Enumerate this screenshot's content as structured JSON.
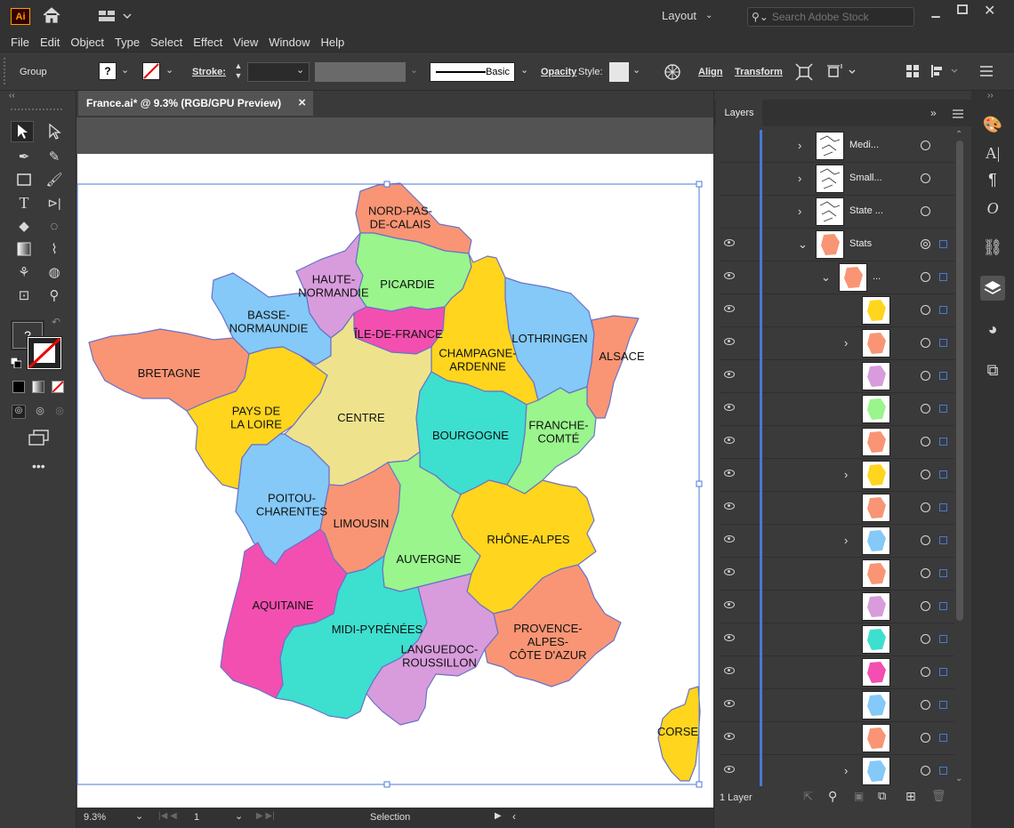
{
  "app": {
    "logo": "Ai",
    "layout_label": "Layout",
    "search_placeholder": "Search Adobe Stock"
  },
  "menu": [
    "File",
    "Edit",
    "Object",
    "Type",
    "Select",
    "Effect",
    "View",
    "Window",
    "Help"
  ],
  "control_bar": {
    "selection_type": "Group",
    "fill_value": "?",
    "stroke_label": "Stroke:",
    "brush_label": "Basic",
    "opacity_label": "Opacity",
    "style_label": "Style:",
    "align_label": "Align",
    "transform_label": "Transform"
  },
  "document": {
    "tab_title": "France.ai* @ 9.3% (RGB/GPU Preview)",
    "close_glyph": "×"
  },
  "status_bar": {
    "zoom": "9.3%",
    "artboard_number": "1",
    "tool_name": "Selection"
  },
  "map": {
    "regions": [
      {
        "name": "NORD-PAS-\nDE-CALAIS",
        "color": "#F99574"
      },
      {
        "name": "PICARDIE",
        "color": "#99F58C"
      },
      {
        "name": "HAUTE-\nNORMANDIE",
        "color": "#D89CDC"
      },
      {
        "name": "BASSE-\nNORMAUNDIE",
        "color": "#84C9F8"
      },
      {
        "name": "ÎLE-DE-FRANCE",
        "color": "#F34FB0"
      },
      {
        "name": "CHAMPAGNE-\nARDENNE",
        "color": "#FFD51D"
      },
      {
        "name": "LOTHRINGEN",
        "color": "#84C9F8"
      },
      {
        "name": "ALSACE",
        "color": "#F99574"
      },
      {
        "name": "BRETAGNE",
        "color": "#F99574"
      },
      {
        "name": "PAYS DE\nLA LOIRE",
        "color": "#FFD51D"
      },
      {
        "name": "CENTRE",
        "color": "#EEE38C"
      },
      {
        "name": "BOURGOGNE",
        "color": "#3DDFCF"
      },
      {
        "name": "FRANCHE-\nCOMTÉ",
        "color": "#99F58C"
      },
      {
        "name": "POITOU-\nCHARENTES",
        "color": "#84C9F8"
      },
      {
        "name": "LIMOUSIN",
        "color": "#F99574"
      },
      {
        "name": "AUVERGNE",
        "color": "#99F58C"
      },
      {
        "name": "RHÔNE-ALPES",
        "color": "#FFD51D"
      },
      {
        "name": "AQUITAINE",
        "color": "#F34FB0"
      },
      {
        "name": "MIDI-PYRÉNÉES",
        "color": "#3DDFCF"
      },
      {
        "name": "LANGUEDOC-\nROUSSILLON",
        "color": "#D89CDC"
      },
      {
        "name": "PROVENCE-\nALPES-\nCÔTE D'AZUR",
        "color": "#F99574"
      },
      {
        "name": "CORSE",
        "color": "#FFD51D"
      }
    ]
  },
  "layers_panel": {
    "tab_label": "Layers",
    "footer_label": "1 Layer",
    "rows": [
      {
        "name": "Medi...",
        "expand": true,
        "eye": false,
        "indent": 0,
        "thumb": "#ffffff",
        "target": "ring",
        "selected": false
      },
      {
        "name": "Small...",
        "expand": true,
        "eye": false,
        "indent": 0,
        "thumb": "#ffffff",
        "target": "ring",
        "selected": false
      },
      {
        "name": "State ...",
        "expand": true,
        "eye": false,
        "indent": 0,
        "thumb": "#ffffff",
        "target": "ring",
        "selected": false
      },
      {
        "name": "Stats",
        "expand": "open",
        "eye": true,
        "indent": 0,
        "thumb": "#F99574",
        "target": "double",
        "selected": true
      },
      {
        "name": "...",
        "expand": "open",
        "eye": true,
        "indent": 1,
        "thumb": "#F99574",
        "target": "ring",
        "selected": true
      },
      {
        "name": "",
        "expand": false,
        "eye": true,
        "indent": 2,
        "thumb": "#FFD51D",
        "target": "ring",
        "selected": true
      },
      {
        "name": "",
        "expand": true,
        "eye": true,
        "indent": 2,
        "thumb": "#F99574",
        "target": "ring",
        "selected": true
      },
      {
        "name": "",
        "expand": false,
        "eye": true,
        "indent": 2,
        "thumb": "#D89CDC",
        "target": "ring",
        "selected": true
      },
      {
        "name": "",
        "expand": false,
        "eye": true,
        "indent": 2,
        "thumb": "#99F58C",
        "target": "ring",
        "selected": true
      },
      {
        "name": "",
        "expand": false,
        "eye": true,
        "indent": 2,
        "thumb": "#F99574",
        "target": "ring",
        "selected": true
      },
      {
        "name": "",
        "expand": true,
        "eye": true,
        "indent": 2,
        "thumb": "#FFD51D",
        "target": "ring",
        "selected": true
      },
      {
        "name": "",
        "expand": false,
        "eye": true,
        "indent": 2,
        "thumb": "#F99574",
        "target": "ring",
        "selected": true
      },
      {
        "name": "",
        "expand": true,
        "eye": true,
        "indent": 2,
        "thumb": "#84C9F8",
        "target": "ring",
        "selected": true
      },
      {
        "name": "",
        "expand": false,
        "eye": true,
        "indent": 2,
        "thumb": "#F99574",
        "target": "ring",
        "selected": true
      },
      {
        "name": "",
        "expand": false,
        "eye": true,
        "indent": 2,
        "thumb": "#D89CDC",
        "target": "ring",
        "selected": true
      },
      {
        "name": "",
        "expand": false,
        "eye": true,
        "indent": 2,
        "thumb": "#3DDFCF",
        "target": "ring",
        "selected": true
      },
      {
        "name": "",
        "expand": false,
        "eye": true,
        "indent": 2,
        "thumb": "#F34FB0",
        "target": "ring",
        "selected": true
      },
      {
        "name": "",
        "expand": false,
        "eye": true,
        "indent": 2,
        "thumb": "#84C9F8",
        "target": "ring",
        "selected": true
      },
      {
        "name": "",
        "expand": false,
        "eye": true,
        "indent": 2,
        "thumb": "#F99574",
        "target": "ring",
        "selected": true
      },
      {
        "name": "",
        "expand": true,
        "eye": true,
        "indent": 2,
        "thumb": "#84C9F8",
        "target": "ring",
        "selected": true
      }
    ]
  }
}
